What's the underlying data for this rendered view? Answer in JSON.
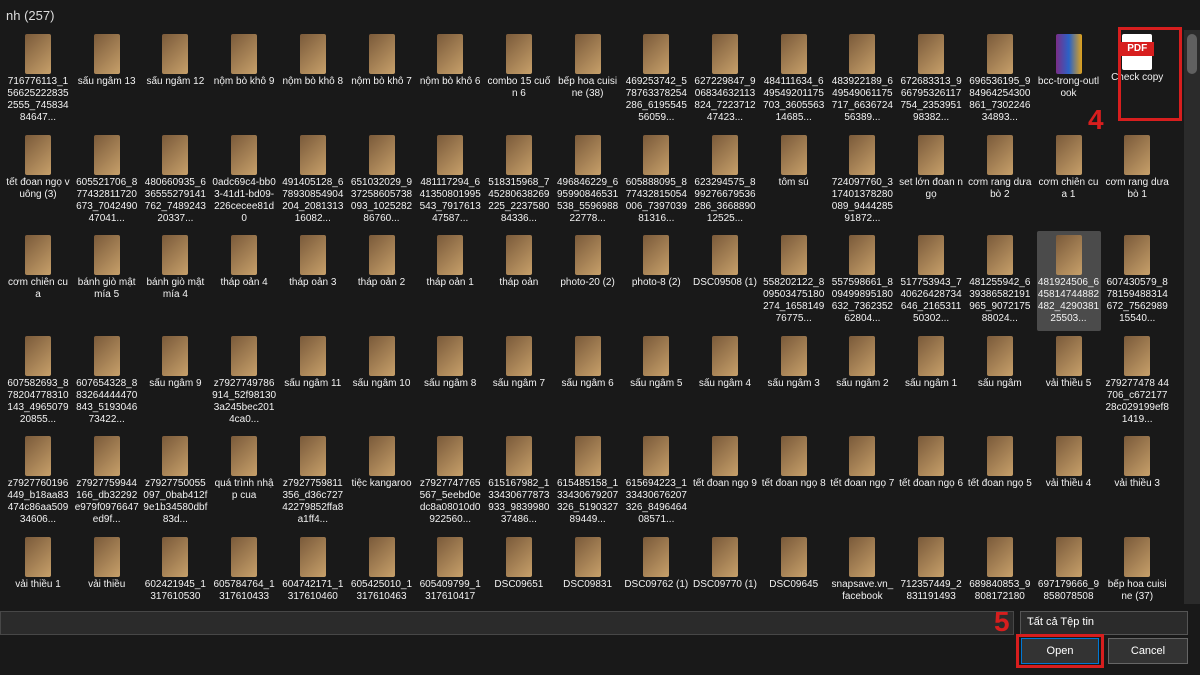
{
  "header": {
    "title": "nh (257)"
  },
  "files": [
    {
      "r": 0,
      "c": 0,
      "label": "716776113_1566252228352555_74583484647...",
      "type": "image"
    },
    {
      "r": 0,
      "c": 1,
      "label": "sấu ngâm 13",
      "type": "image"
    },
    {
      "r": 0,
      "c": 2,
      "label": "sấu ngâm 12",
      "type": "image"
    },
    {
      "r": 0,
      "c": 3,
      "label": "nộm bò khô 9",
      "type": "image"
    },
    {
      "r": 0,
      "c": 4,
      "label": "nộm bò khô 8",
      "type": "image"
    },
    {
      "r": 0,
      "c": 5,
      "label": "nộm bò khô 7",
      "type": "image"
    },
    {
      "r": 0,
      "c": 6,
      "label": "nộm bò khô 6",
      "type": "image"
    },
    {
      "r": 0,
      "c": 7,
      "label": "combo 15 cuốn 6",
      "type": "image"
    },
    {
      "r": 0,
      "c": 8,
      "label": "bếp hoa cuisine (38)",
      "type": "image"
    },
    {
      "r": 0,
      "c": 9,
      "label": "469253742_578763378254286_619554556059...",
      "type": "image"
    },
    {
      "r": 0,
      "c": 10,
      "label": "627229847_906834632113824_722371247423...",
      "type": "image"
    },
    {
      "r": 0,
      "c": 11,
      "label": "484111634_649549201175703_360556314685...",
      "type": "image"
    },
    {
      "r": 0,
      "c": 12,
      "label": "483922189_649549061175717_663672456389...",
      "type": "image"
    },
    {
      "r": 0,
      "c": 13,
      "label": "672683313_966795326117754_235395198382...",
      "type": "image"
    },
    {
      "r": 0,
      "c": 14,
      "label": "696536195_984964254300861_730224634893...",
      "type": "image"
    },
    {
      "r": 0,
      "c": 15,
      "label": "bcc-trong-outlook",
      "type": "rar"
    },
    {
      "r": 0,
      "c": 16,
      "label": "Check copy",
      "type": "pdf"
    },
    {
      "r": 1,
      "c": 0,
      "label": "tết đoan ngọ vuông (3)",
      "type": "image"
    },
    {
      "r": 1,
      "c": 1,
      "label": "605521706_877432811720673_704249047041...",
      "type": "image"
    },
    {
      "r": 1,
      "c": 2,
      "label": "480660935_636555279141762_748924320337...",
      "type": "image"
    },
    {
      "r": 1,
      "c": 3,
      "label": "0adc69c4-bb03-41d1-bd09-226cecee81d0",
      "type": "image"
    },
    {
      "r": 1,
      "c": 4,
      "label": "491405128_678930854904204_208131316082...",
      "type": "image"
    },
    {
      "r": 1,
      "c": 5,
      "label": "651032029_937258605738093_102528286760...",
      "type": "image"
    },
    {
      "r": 1,
      "c": 6,
      "label": "481117294_641350801995543_791761347587...",
      "type": "image"
    },
    {
      "r": 1,
      "c": 7,
      "label": "518315968_745280638269225_223758084336...",
      "type": "image"
    },
    {
      "r": 1,
      "c": 8,
      "label": "496846229_695990846531538_559698822778...",
      "type": "image"
    },
    {
      "r": 1,
      "c": 9,
      "label": "605888095_877432815054006_739703981316...",
      "type": "image"
    },
    {
      "r": 1,
      "c": 10,
      "label": "623294575_899276679536286_366889012525...",
      "type": "image"
    },
    {
      "r": 1,
      "c": 11,
      "label": "tôm sú",
      "type": "image"
    },
    {
      "r": 1,
      "c": 12,
      "label": "724097760_317401378280089_944428591872...",
      "type": "image"
    },
    {
      "r": 1,
      "c": 13,
      "label": "set lớn đoan ngọ",
      "type": "image"
    },
    {
      "r": 1,
      "c": 14,
      "label": "cơm rang dưa bò 2",
      "type": "image"
    },
    {
      "r": 1,
      "c": 15,
      "label": "cơm chiên cua 1",
      "type": "image"
    },
    {
      "r": 1,
      "c": 16,
      "label": "cơm rang dưa bò 1",
      "type": "image"
    },
    {
      "r": 2,
      "c": 0,
      "label": "cơm chiên cua",
      "type": "image"
    },
    {
      "r": 2,
      "c": 1,
      "label": "bánh giò mật mía 5",
      "type": "image"
    },
    {
      "r": 2,
      "c": 2,
      "label": "bánh giò mật mía 4",
      "type": "image"
    },
    {
      "r": 2,
      "c": 3,
      "label": "tháp oản 4",
      "type": "image"
    },
    {
      "r": 2,
      "c": 4,
      "label": "tháp oản 3",
      "type": "image"
    },
    {
      "r": 2,
      "c": 5,
      "label": "tháp oản 2",
      "type": "image"
    },
    {
      "r": 2,
      "c": 6,
      "label": "tháp oản 1",
      "type": "image"
    },
    {
      "r": 2,
      "c": 7,
      "label": "tháp oản",
      "type": "image"
    },
    {
      "r": 2,
      "c": 8,
      "label": "photo-20 (2)",
      "type": "image"
    },
    {
      "r": 2,
      "c": 9,
      "label": "photo-8 (2)",
      "type": "image"
    },
    {
      "r": 2,
      "c": 10,
      "label": "DSC09508 (1)",
      "type": "image"
    },
    {
      "r": 2,
      "c": 11,
      "label": "558202122_809503475180274_165814976775...",
      "type": "image"
    },
    {
      "r": 2,
      "c": 12,
      "label": "557598661_809499895180632_736235262804...",
      "type": "image"
    },
    {
      "r": 2,
      "c": 13,
      "label": "517753943_740626428734646_216531150302...",
      "type": "image"
    },
    {
      "r": 2,
      "c": 14,
      "label": "481255942_639386582191965_907217588024...",
      "type": "image"
    },
    {
      "r": 2,
      "c": 15,
      "label": "481924506_645814744882482_429038125503...",
      "type": "image",
      "selected": true
    },
    {
      "r": 2,
      "c": 16,
      "label": "607430579_878159488314672_756298915540...",
      "type": "image"
    },
    {
      "r": 3,
      "c": 0,
      "label": "607582693_878204778310143_496507920855...",
      "type": "image"
    },
    {
      "r": 3,
      "c": 1,
      "label": "607654328_883264444470843_519304673422...",
      "type": "image"
    },
    {
      "r": 3,
      "c": 2,
      "label": "sấu ngâm 9",
      "type": "image"
    },
    {
      "r": 3,
      "c": 3,
      "label": "z7927749786914_52f981303a245bec2014ca0...",
      "type": "image"
    },
    {
      "r": 3,
      "c": 4,
      "label": "sấu ngâm 11",
      "type": "image"
    },
    {
      "r": 3,
      "c": 5,
      "label": "sấu ngâm 10",
      "type": "image"
    },
    {
      "r": 3,
      "c": 6,
      "label": "sấu ngâm 8",
      "type": "image"
    },
    {
      "r": 3,
      "c": 7,
      "label": "sấu ngâm 7",
      "type": "image"
    },
    {
      "r": 3,
      "c": 8,
      "label": "sấu ngâm 6",
      "type": "image"
    },
    {
      "r": 3,
      "c": 9,
      "label": "sấu ngâm 5",
      "type": "image"
    },
    {
      "r": 3,
      "c": 10,
      "label": "sấu ngâm 4",
      "type": "image"
    },
    {
      "r": 3,
      "c": 11,
      "label": "sấu ngâm 3",
      "type": "image"
    },
    {
      "r": 3,
      "c": 12,
      "label": "sấu ngâm 2",
      "type": "image"
    },
    {
      "r": 3,
      "c": 13,
      "label": "sấu ngâm 1",
      "type": "image"
    },
    {
      "r": 3,
      "c": 14,
      "label": "sấu ngâm",
      "type": "image"
    },
    {
      "r": 3,
      "c": 15,
      "label": "vải thiều 5",
      "type": "image"
    },
    {
      "r": 3,
      "c": 16,
      "label": "z79277478 44706_c67217728c029199ef81419...",
      "type": "image"
    },
    {
      "r": 4,
      "c": 0,
      "label": "z7927760196449_b18aa83474c86aa50934606...",
      "type": "image"
    },
    {
      "r": 4,
      "c": 1,
      "label": "z7927759944166_db32292e979f0976647ed9f...",
      "type": "image"
    },
    {
      "r": 4,
      "c": 2,
      "label": "z7927750055097_0bab412f9e1b34580dbf83d...",
      "type": "image"
    },
    {
      "r": 4,
      "c": 3,
      "label": "quá trình nhập cua",
      "type": "image"
    },
    {
      "r": 4,
      "c": 4,
      "label": "z7927759811356_d36c72742279852ffa8a1ff4...",
      "type": "image"
    },
    {
      "r": 4,
      "c": 5,
      "label": "tiệc kangaroo",
      "type": "image"
    },
    {
      "r": 4,
      "c": 6,
      "label": "z7927747765567_5eebd0edc8a08010d0922560...",
      "type": "image"
    },
    {
      "r": 4,
      "c": 7,
      "label": "615167982_133430677873933_983998037486...",
      "type": "image"
    },
    {
      "r": 4,
      "c": 8,
      "label": "615485158_133430679207326_519032789449...",
      "type": "image"
    },
    {
      "r": 4,
      "c": 9,
      "label": "615694223_133430676207326_849646408571...",
      "type": "image"
    },
    {
      "r": 4,
      "c": 10,
      "label": "tết đoan ngọ 9",
      "type": "image"
    },
    {
      "r": 4,
      "c": 11,
      "label": "tết đoan ngọ 8",
      "type": "image"
    },
    {
      "r": 4,
      "c": 12,
      "label": "tết đoan ngọ 7",
      "type": "image"
    },
    {
      "r": 4,
      "c": 13,
      "label": "tết đoan ngọ 6",
      "type": "image"
    },
    {
      "r": 4,
      "c": 14,
      "label": "tết đoan ngọ 5",
      "type": "image"
    },
    {
      "r": 4,
      "c": 15,
      "label": "vải thiều 4",
      "type": "image"
    },
    {
      "r": 4,
      "c": 16,
      "label": "vải thiều 3",
      "type": "image"
    },
    {
      "r": 5,
      "c": 0,
      "label": "vải thiều 1",
      "type": "image"
    },
    {
      "r": 5,
      "c": 1,
      "label": "vải thiều",
      "type": "image"
    },
    {
      "r": 5,
      "c": 2,
      "label": "602421945_1317610530",
      "type": "image"
    },
    {
      "r": 5,
      "c": 3,
      "label": "605784764_1317610433",
      "type": "image"
    },
    {
      "r": 5,
      "c": 4,
      "label": "604742171_1317610460",
      "type": "image"
    },
    {
      "r": 5,
      "c": 5,
      "label": "605425010_1317610463",
      "type": "image"
    },
    {
      "r": 5,
      "c": 6,
      "label": "605409799_1317610417",
      "type": "image"
    },
    {
      "r": 5,
      "c": 7,
      "label": "DSC09651",
      "type": "image"
    },
    {
      "r": 5,
      "c": 8,
      "label": "DSC09831",
      "type": "image"
    },
    {
      "r": 5,
      "c": 9,
      "label": "DSC09762 (1)",
      "type": "image"
    },
    {
      "r": 5,
      "c": 10,
      "label": "DSC09770 (1)",
      "type": "image"
    },
    {
      "r": 5,
      "c": 11,
      "label": "DSC09645",
      "type": "image"
    },
    {
      "r": 5,
      "c": 12,
      "label": "snapsave.vn_facebook",
      "type": "image"
    },
    {
      "r": 5,
      "c": 13,
      "label": "712357449_2831191493",
      "type": "image"
    },
    {
      "r": 5,
      "c": 14,
      "label": "689840853_9808172180",
      "type": "image"
    },
    {
      "r": 5,
      "c": 15,
      "label": "697179666_9858078508",
      "type": "image"
    },
    {
      "r": 5,
      "c": 16,
      "label": "bếp hoa cuisine (37)",
      "type": "image"
    }
  ],
  "pdf_tag": "PDF",
  "filename_input": {
    "value": ""
  },
  "filter": {
    "selected": "Tất cả Tệp tin",
    "chevron": "⌄"
  },
  "buttons": {
    "open": "Open",
    "cancel": "Cancel"
  },
  "markers": {
    "step4": "4",
    "step5": "5"
  }
}
